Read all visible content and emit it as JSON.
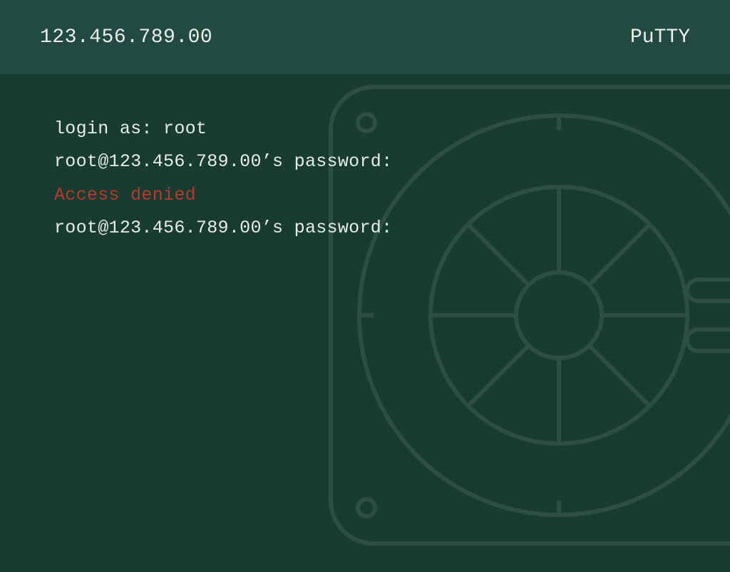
{
  "titlebar": {
    "host": "123.456.789.00",
    "app": "PuTTY"
  },
  "terminal": {
    "lines": [
      {
        "text": "login as: root",
        "type": "normal"
      },
      {
        "text": "root@123.456.789.00’s password:",
        "type": "normal"
      },
      {
        "text": "Access denied",
        "type": "error"
      },
      {
        "text": "root@123.456.789.00’s password:",
        "type": "normal"
      }
    ]
  },
  "colors": {
    "bg": "#183b32",
    "titlebar_bg": "#234a40",
    "text": "#e7eceb",
    "error": "#b83a2b"
  }
}
